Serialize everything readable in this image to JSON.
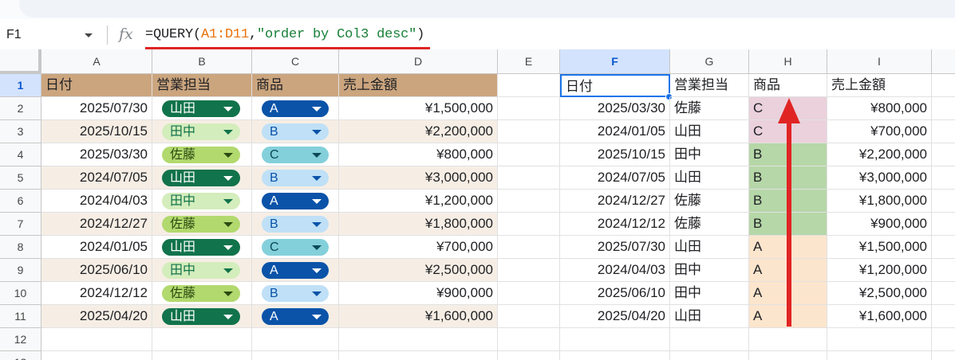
{
  "namebox": {
    "value": "F1"
  },
  "formula": {
    "icon": "fx",
    "prefix": "=QUERY(",
    "range": "A1:D11",
    "comma": ",",
    "string": "\"order by Col3 desc\"",
    "suffix": ")"
  },
  "columns": [
    "A",
    "B",
    "C",
    "D",
    "E",
    "F",
    "G",
    "H",
    "I"
  ],
  "row_numbers": [
    "1",
    "2",
    "3",
    "4",
    "5",
    "6",
    "7",
    "8",
    "9",
    "10",
    "11",
    "12",
    "13"
  ],
  "source": {
    "headers": [
      "日付",
      "営業担当",
      "商品",
      "売上金額"
    ],
    "rows": [
      {
        "date": "2025/07/30",
        "rep": "山田",
        "product": "A",
        "amount": "¥1,500,000"
      },
      {
        "date": "2025/10/15",
        "rep": "田中",
        "product": "B",
        "amount": "¥2,200,000"
      },
      {
        "date": "2025/03/30",
        "rep": "佐藤",
        "product": "C",
        "amount": "¥800,000"
      },
      {
        "date": "2024/07/05",
        "rep": "山田",
        "product": "B",
        "amount": "¥3,000,000"
      },
      {
        "date": "2024/04/03",
        "rep": "田中",
        "product": "A",
        "amount": "¥1,200,000"
      },
      {
        "date": "2024/12/27",
        "rep": "佐藤",
        "product": "B",
        "amount": "¥1,800,000"
      },
      {
        "date": "2024/01/05",
        "rep": "山田",
        "product": "C",
        "amount": "¥700,000"
      },
      {
        "date": "2025/06/10",
        "rep": "田中",
        "product": "A",
        "amount": "¥2,500,000"
      },
      {
        "date": "2024/12/12",
        "rep": "佐藤",
        "product": "B",
        "amount": "¥900,000"
      },
      {
        "date": "2025/04/20",
        "rep": "山田",
        "product": "A",
        "amount": "¥1,600,000"
      }
    ]
  },
  "result": {
    "headers": [
      "日付",
      "営業担当",
      "商品",
      "売上金額"
    ],
    "rows": [
      {
        "date": "2025/03/30",
        "rep": "佐藤",
        "product": "C",
        "amount": "¥800,000"
      },
      {
        "date": "2024/01/05",
        "rep": "山田",
        "product": "C",
        "amount": "¥700,000"
      },
      {
        "date": "2025/10/15",
        "rep": "田中",
        "product": "B",
        "amount": "¥2,200,000"
      },
      {
        "date": "2024/07/05",
        "rep": "山田",
        "product": "B",
        "amount": "¥3,000,000"
      },
      {
        "date": "2024/12/27",
        "rep": "佐藤",
        "product": "B",
        "amount": "¥1,800,000"
      },
      {
        "date": "2024/12/12",
        "rep": "佐藤",
        "product": "B",
        "amount": "¥900,000"
      },
      {
        "date": "2025/07/30",
        "rep": "山田",
        "product": "A",
        "amount": "¥1,500,000"
      },
      {
        "date": "2024/04/03",
        "rep": "田中",
        "product": "A",
        "amount": "¥1,200,000"
      },
      {
        "date": "2025/06/10",
        "rep": "田中",
        "product": "A",
        "amount": "¥2,500,000"
      },
      {
        "date": "2025/04/20",
        "rep": "山田",
        "product": "A",
        "amount": "¥1,600,000"
      }
    ]
  },
  "colors": {
    "header_fill": "#cba57e",
    "band_fill": "#f6eee5",
    "product_c_fill": "#ead1dc",
    "product_b_fill": "#b6d7a8",
    "product_a_fill": "#fce5cd",
    "annotation": "#e02424",
    "selection": "#1a73e8"
  },
  "selected_cell": "F1"
}
